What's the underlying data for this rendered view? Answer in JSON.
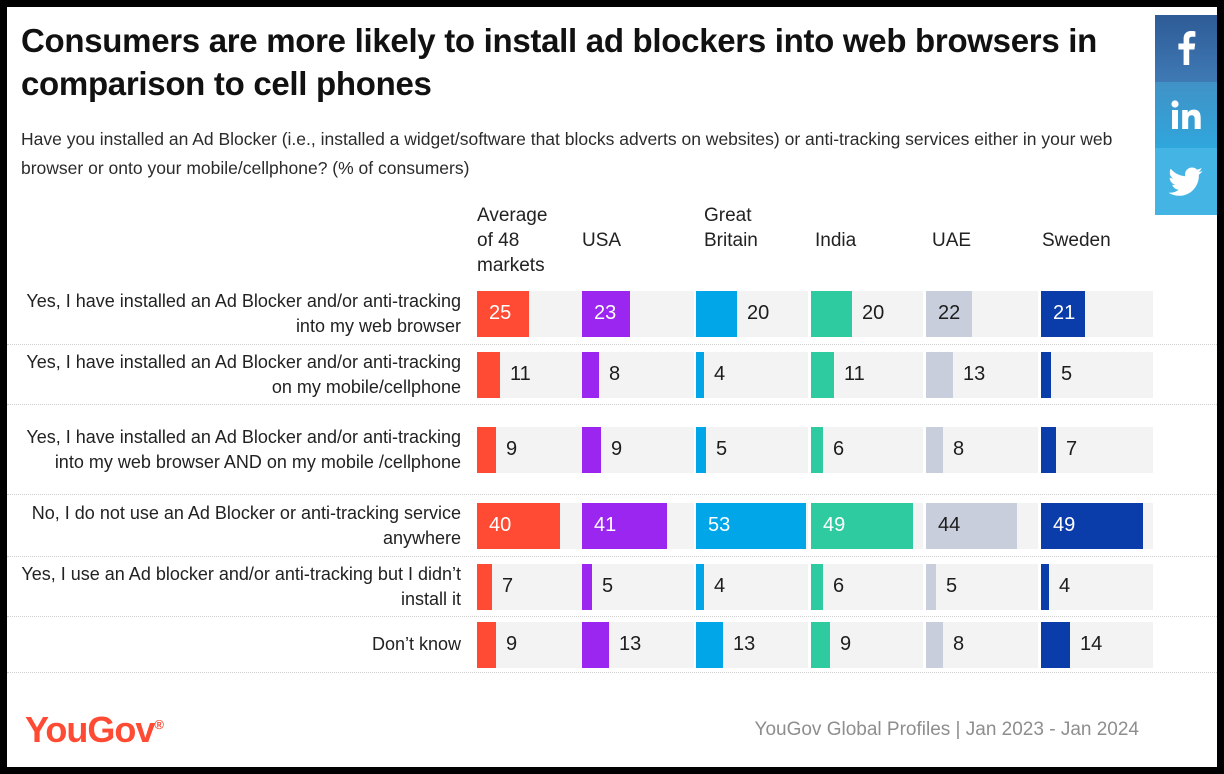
{
  "headline": "Consumers are more likely to install ad blockers into web browsers in comparison to cell phones",
  "subtitle": "Have you installed an Ad Blocker (i.e., installed a widget/software that blocks adverts on websites) or anti-tracking services either in your web browser or onto your mobile/cellphone? (% of consumers)",
  "social": [
    {
      "name": "facebook",
      "glyph": "f",
      "color": "#3f7ab5"
    },
    {
      "name": "linkedin",
      "glyph": "in",
      "color": "#2fa6dc"
    },
    {
      "name": "twitter",
      "glyph": "twitter-bird",
      "color": "#44b4e4"
    }
  ],
  "footer": {
    "logo": "YouGov",
    "logo_mark": "®",
    "source": "YouGov Global Profiles | Jan 2023 - Jan 2024"
  },
  "chart_data": {
    "type": "bar",
    "title": "Consumers are more likely to install ad blockers into web browsers in comparison to cell phones",
    "subtitle": "Have you installed an Ad Blocker (i.e., installed a widget/software that blocks adverts on websites) or anti-tracking services either in your web browser or onto your mobile/cellphone? (% of consumers)",
    "xlabel": "",
    "ylabel": "% of consumers",
    "xlim": [
      0,
      54
    ],
    "grid": false,
    "legend_position": "top (column headers)",
    "orientation": "horizontal",
    "categories": [
      "Yes, I have installed an Ad Blocker and/or anti-tracking into my web browser",
      "Yes, I have installed an Ad Blocker and/or anti-tracking on my mobile/cellphone",
      "Yes, I have installed an Ad Blocker and/or anti-tracking into my web browser AND on my mobile /cellphone",
      "No, I do not use an Ad Blocker or anti-tracking service anywhere",
      "Yes, I use an Ad blocker and/or anti-tracking but I didn’t install it",
      "Don’t know"
    ],
    "series": [
      {
        "name": "Average of 48 markets",
        "color": "#ff4b33",
        "values": [
          25,
          11,
          9,
          40,
          7,
          9
        ]
      },
      {
        "name": "USA",
        "color": "#9b26ef",
        "values": [
          23,
          8,
          9,
          41,
          5,
          13
        ]
      },
      {
        "name": "Great Britain",
        "color": "#00a6e8",
        "values": [
          20,
          4,
          5,
          53,
          4,
          13
        ]
      },
      {
        "name": "India",
        "color": "#2ecba0",
        "values": [
          20,
          11,
          6,
          49,
          6,
          9
        ]
      },
      {
        "name": "UAE",
        "color": "#c9cedc",
        "values": [
          22,
          13,
          8,
          44,
          5,
          8
        ]
      },
      {
        "name": "Sweden",
        "color": "#0a3caa",
        "values": [
          21,
          5,
          7,
          49,
          4,
          14
        ]
      }
    ]
  }
}
